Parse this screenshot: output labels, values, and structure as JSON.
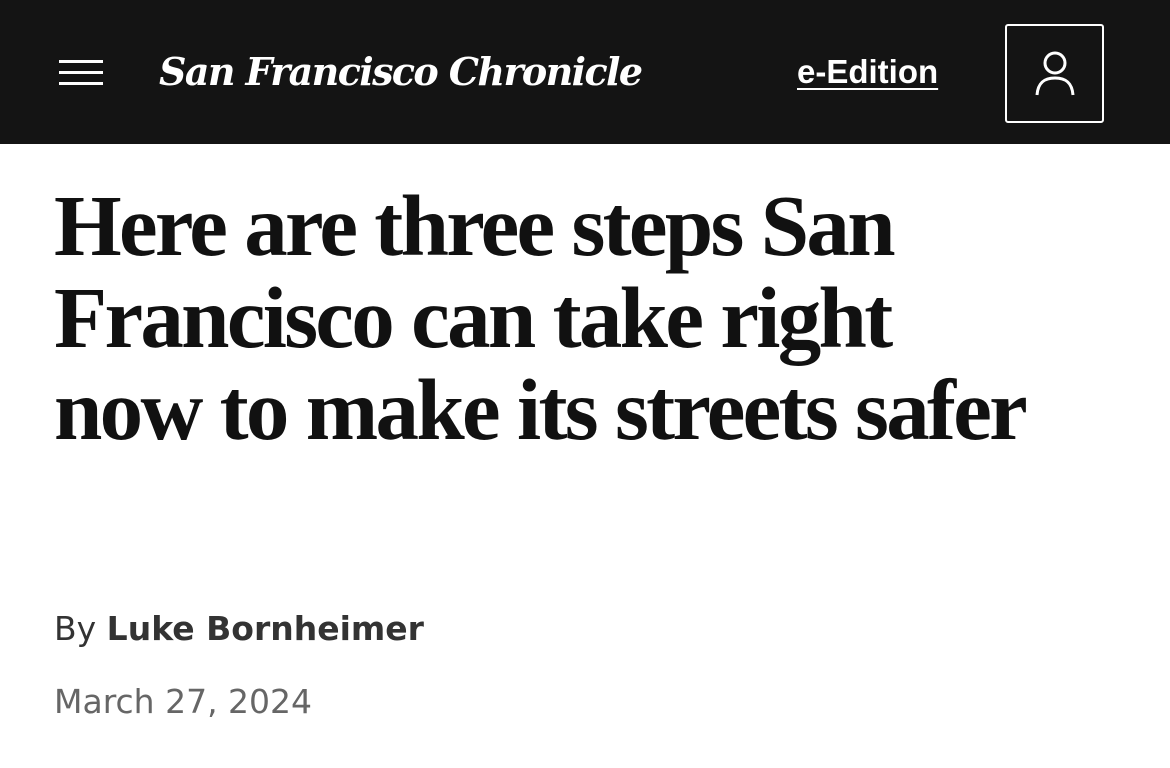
{
  "header": {
    "menu_icon": "hamburger-menu-icon",
    "brand": "San Francisco Chronicle",
    "e_edition_label": "e-Edition",
    "account_icon": "user-icon",
    "background": "#141414"
  },
  "article": {
    "headline": "Here are three steps San Francisco can take right now to make its streets safer",
    "byline_prefix": "By",
    "author": "Luke Bornheimer",
    "date": "March 27, 2024"
  }
}
